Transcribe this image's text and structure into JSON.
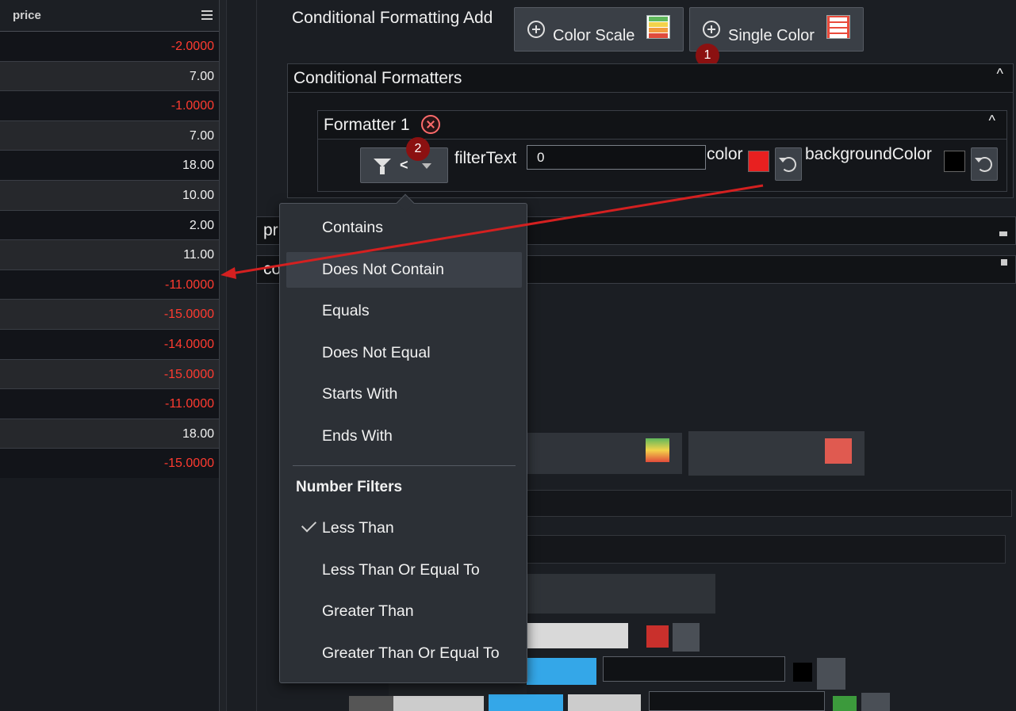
{
  "grid": {
    "column_header": "price",
    "rows": [
      {
        "value": "-2.0000",
        "negative": true
      },
      {
        "value": "7.00",
        "negative": false
      },
      {
        "value": "-1.0000",
        "negative": true
      },
      {
        "value": "7.00",
        "negative": false
      },
      {
        "value": "18.00",
        "negative": false
      },
      {
        "value": "10.00",
        "negative": false
      },
      {
        "value": "2.00",
        "negative": false
      },
      {
        "value": "11.00",
        "negative": false
      },
      {
        "value": "-11.0000",
        "negative": true
      },
      {
        "value": "-15.0000",
        "negative": true
      },
      {
        "value": "-14.0000",
        "negative": true
      },
      {
        "value": "-15.0000",
        "negative": true
      },
      {
        "value": "-11.0000",
        "negative": true
      },
      {
        "value": "18.00",
        "negative": false
      },
      {
        "value": "-15.0000",
        "negative": true
      }
    ]
  },
  "panel": {
    "add_title": "Conditional Formatting Add",
    "color_scale_label": "Color Scale",
    "single_color_label": "Single Color",
    "badge_1": "1",
    "badge_2": "2",
    "formatters_title": "Conditional Formatters",
    "collapse_caret": "^",
    "formatter_title": "Formatter 1",
    "operator": "<",
    "filter_text_label": "filterText",
    "filter_text_value": "0",
    "color_label": "color",
    "color_value": "#e82020",
    "background_color_label": "backgroundColor",
    "background_color_value": "#000000",
    "partial_row_1": "pr",
    "partial_row_2": "co"
  },
  "dropdown": {
    "text_filters": [
      "Contains",
      "Does Not Contain",
      "Equals",
      "Does Not Equal",
      "Starts With",
      "Ends With"
    ],
    "hovered": "Does Not Contain",
    "group_label": "Number Filters",
    "number_filters": [
      "Less Than",
      "Less Than Or Equal To",
      "Greater Than",
      "Greater Than Or Equal To"
    ],
    "selected": "Less Than"
  },
  "colors": {
    "negative_text": "#ff3b30",
    "annotation_arrow": "#d42020",
    "badge": "#8b1111"
  }
}
